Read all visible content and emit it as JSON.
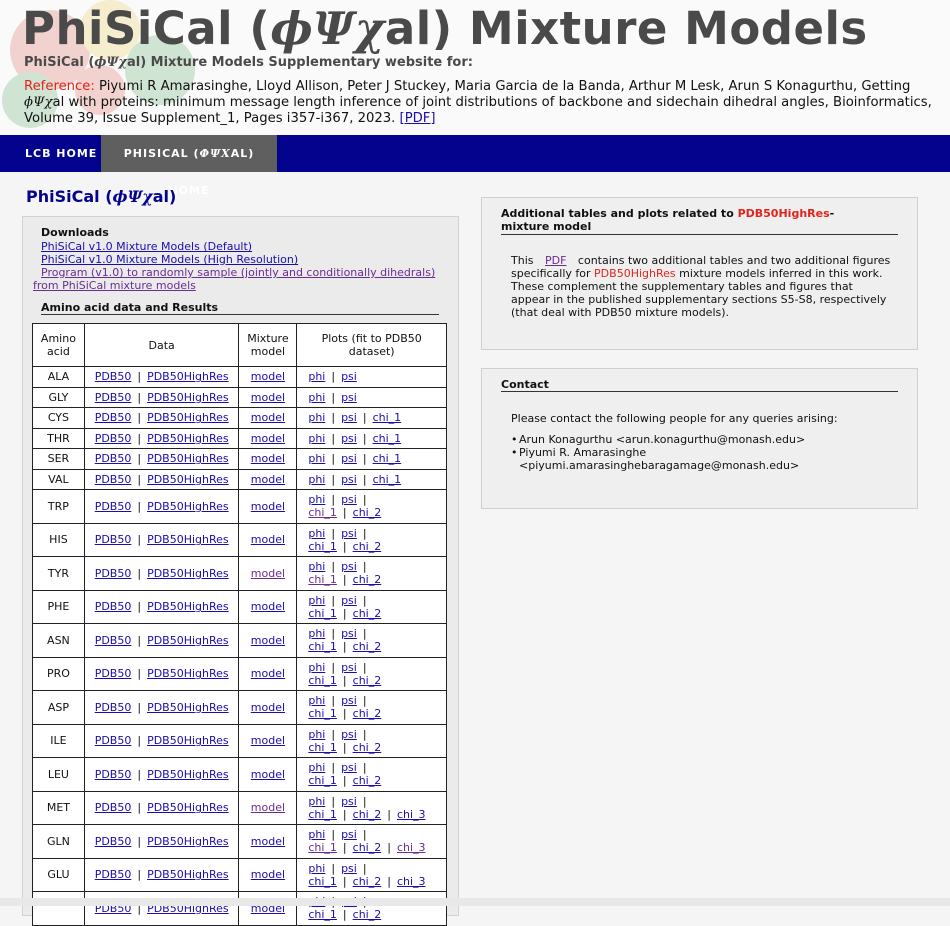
{
  "header": {
    "title_prefix": "PhiSiCal (",
    "title_greek": "ϕΨχ",
    "title_suffix": "al) Mixture Models",
    "subtitle_prefix": "PhiSiCal (",
    "subtitle_greek": "ϕΨχ",
    "subtitle_suffix": "al) Mixture Models Supplementary website for:",
    "reference_label": "Reference:",
    "reference_text_1": " Piyumi R Amarasinghe, Lloyd Allison, Peter J Stuckey, Maria Garcia de la Banda, Arthur M Lesk, Arun S Konagurthu, Getting ",
    "reference_greek": "ϕΨχ",
    "reference_text_2": "al with proteins: minimum message length inference of joint distributions of backbone and sidechain dihedral angles, Bioinformatics, Volume 39, Issue Supplement_1, Pages i357-i367, 2023. ",
    "reference_pdf": "[PDF]"
  },
  "nav": {
    "lcb_home": "LCB HOME",
    "phisical_home_prefix": "PHISICAL (",
    "phisical_home_greek": "ϕΨχ",
    "phisical_home_suffix": "AL) HOME"
  },
  "left": {
    "title_prefix": "PhiSiCal (",
    "title_greek": "ϕΨχ",
    "title_suffix": "al)",
    "downloads_head": "Downloads",
    "downloads": [
      "PhiSiCal v1.0 Mixture Models (Default)",
      "PhiSiCal v1.0 Mixture Models (High Resolution)",
      "Program (v1.0) to randomly sample (jointly and conditionally dihedrals)",
      "from PhiSiCal mixture models"
    ],
    "amino_head": "Amino acid data and Results",
    "table": {
      "headers": [
        "Amino acid",
        "Data",
        "Mixture model",
        "Plots (fit to PDB50 dataset)"
      ],
      "data_links": [
        "PDB50",
        "PDB50HighRes"
      ],
      "model_link": "model",
      "plot_links": [
        "phi",
        "psi",
        "chi_1",
        "chi_2",
        "chi_3"
      ],
      "rows": [
        {
          "aa": "ALA",
          "chis": 0
        },
        {
          "aa": "GLY",
          "chis": 0
        },
        {
          "aa": "CYS",
          "chis": 1
        },
        {
          "aa": "THR",
          "chis": 1
        },
        {
          "aa": "SER",
          "chis": 1
        },
        {
          "aa": "VAL",
          "chis": 1
        },
        {
          "aa": "TRP",
          "chis": 2
        },
        {
          "aa": "HIS",
          "chis": 2
        },
        {
          "aa": "TYR",
          "chis": 2
        },
        {
          "aa": "PHE",
          "chis": 2
        },
        {
          "aa": "ASN",
          "chis": 2
        },
        {
          "aa": "PRO",
          "chis": 2
        },
        {
          "aa": "ASP",
          "chis": 2
        },
        {
          "aa": "ILE",
          "chis": 2
        },
        {
          "aa": "LEU",
          "chis": 2
        },
        {
          "aa": "MET",
          "chis": 3
        },
        {
          "aa": "GLN",
          "chis": 3
        },
        {
          "aa": "GLU",
          "chis": 3
        },
        {
          "aa": "",
          "chis": 2
        }
      ]
    }
  },
  "right": {
    "box1_head_1": "Additional tables and plots related to ",
    "box1_head_red": "PDB50HighRes",
    "box1_head_2": "-mixture model",
    "box1_text_1": "This ",
    "box1_pdf": "PDF",
    "box1_text_2": " contains two additional tables and two additional figures specifically for ",
    "box1_text_red": "PDB50HighRes",
    "box1_text_3": " mixture models inferred in this work. These complement the supplementary tables and figures that appear in the published supplementary sections S5-S8, respectively (that deal with PDB50 mixture models).",
    "box2_head": "Contact",
    "box2_intro": "Please contact the following people for any queries arising:",
    "contacts": [
      "Arun Konagurthu <arun.konagurthu@monash.edu>",
      "Piyumi R. Amarasinghe <piyumi.amarasinghebaragamage@monash.edu>"
    ]
  },
  "colors": {
    "nav_bg": "#03038e",
    "nav_active": "#5f5f5f",
    "accent_red": "#e0241b",
    "link": "#1a0dab"
  }
}
